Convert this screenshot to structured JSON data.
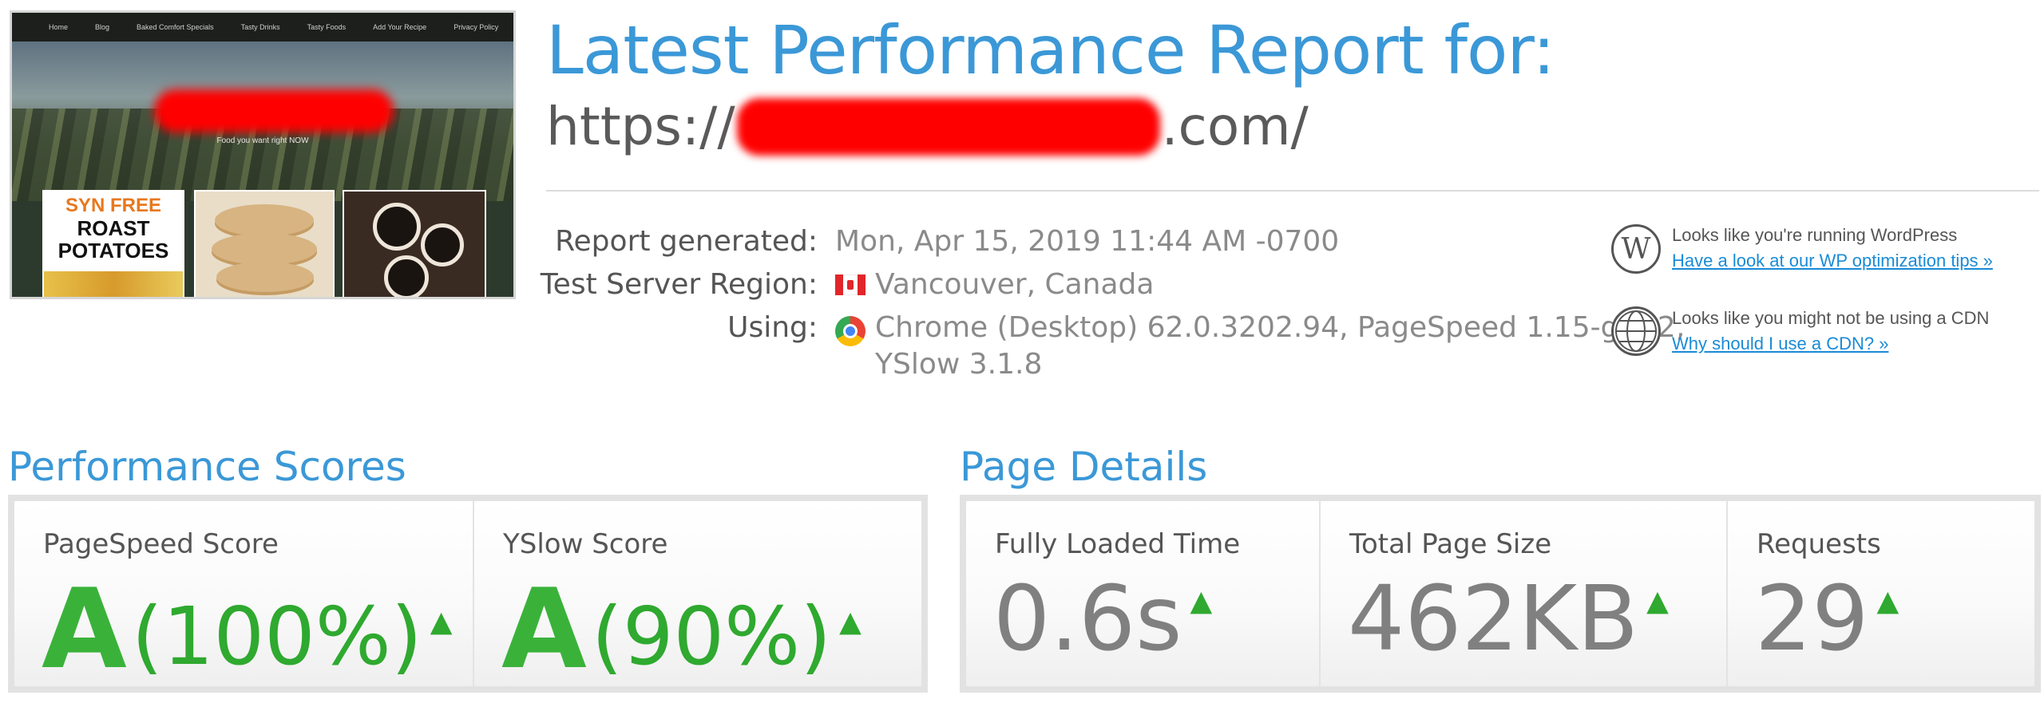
{
  "thumbnail": {
    "nav_items": [
      "Home",
      "Blog",
      "Baked Comfort Specials",
      "Tasty Drinks",
      "Tasty Foods",
      "Add Your Recipe",
      "Privacy Policy"
    ],
    "tagline": "Food you want right NOW",
    "card1_line1": "SYN FREE",
    "card1_line2a": "ROAST",
    "card1_line2b": "POTATOES"
  },
  "header": {
    "title": "Latest Performance Report for:",
    "url_prefix": "https://",
    "url_suffix": ".com/"
  },
  "meta": {
    "report_generated_label": "Report generated:",
    "report_generated_value": "Mon, Apr 15, 2019 11:44 AM -0700",
    "region_label": "Test Server Region:",
    "region_value": "Vancouver, Canada",
    "using_label": "Using:",
    "using_value_line1": "Chrome (Desktop) 62.0.3202.94, PageSpeed 1.15-gt1.2,",
    "using_value_line2": "YSlow 3.1.8"
  },
  "notices": [
    {
      "icon": "wordpress-icon",
      "text": "Looks like you're running WordPress",
      "link": "Have a look at our WP optimization tips »"
    },
    {
      "icon": "globe-icon",
      "text": "Looks like you might not be using a CDN",
      "link": "Why should I use a CDN? »"
    }
  ],
  "performance_scores": {
    "title": "Performance Scores",
    "pagespeed_label": "PageSpeed Score",
    "pagespeed_grade": "A",
    "pagespeed_pct": "(100%)",
    "yslow_label": "YSlow Score",
    "yslow_grade": "A",
    "yslow_pct": "(90%)"
  },
  "page_details": {
    "title": "Page Details",
    "load_time_label": "Fully Loaded Time",
    "load_time_value": "0.6s",
    "page_size_label": "Total Page Size",
    "page_size_value": "462KB",
    "requests_label": "Requests",
    "requests_value": "29"
  },
  "colors": {
    "accent_blue": "#3b98d7",
    "grade_green": "#3ab23a",
    "link_blue": "#1a8bd6",
    "redaction_red": "#ff0000"
  }
}
